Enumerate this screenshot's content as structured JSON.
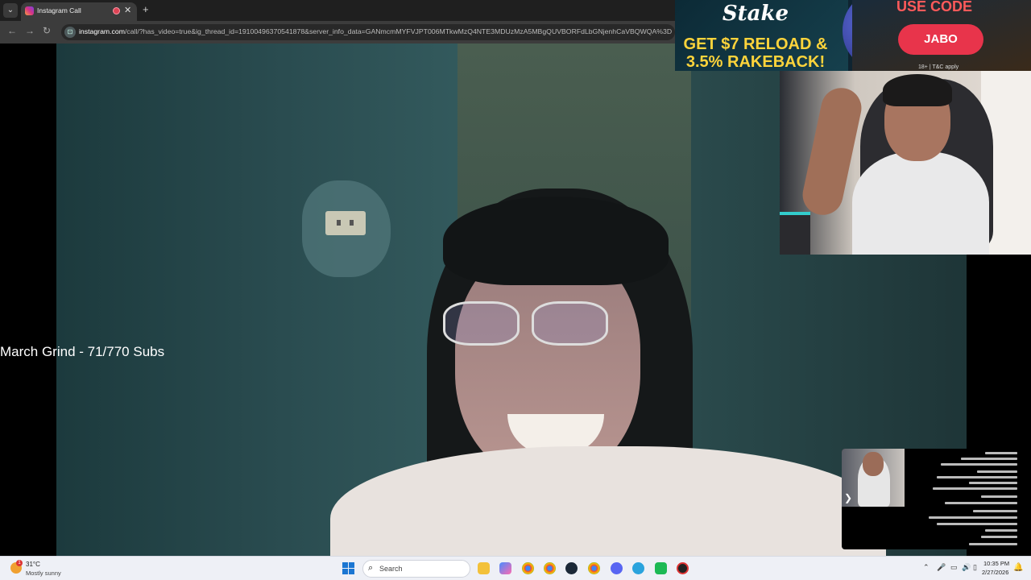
{
  "browser": {
    "tab_menu": "⌄",
    "tab_title": "Instagram Call",
    "tab_close": "✕",
    "new_tab": "+",
    "back": "←",
    "forward": "→",
    "reload": "↻",
    "url_host": "instagram.com",
    "url_path": "/call/?has_video=true&ig_thread_id=191004963705418​78&server_info_data=GANmcmMYFVJPT006MTkwMzQ4NTE3MDUzMzA5MBgQUVBORFdLbGNjenhCaVBQWQA%3D"
  },
  "overlay": {
    "subs_text": "March Grind - 71/770 Subs"
  },
  "ad": {
    "logo": "Stake",
    "headline_1": "GET $7 RELOAD &",
    "headline_2": "3.5% RAKEBACK!",
    "use_code": "USE CODE",
    "code": "JABO",
    "tc": "18+ | T&C apply"
  },
  "pip": {
    "toggle": "❯"
  },
  "taskbar": {
    "weather_badge": "1",
    "temperature": "31°C",
    "weather_desc": "Mostly sunny",
    "search_placeholder": "Search",
    "search_icon": "⌕",
    "tray_chevron": "⌃",
    "tray_mic": "🎤",
    "tray_net": "▭",
    "tray_sound": "🔊",
    "tray_battery": "▯",
    "time": "10:35 PM",
    "date": "2/27/2026",
    "notif": "🔔"
  },
  "colors": {
    "accent_ad_code": "#e8344b",
    "ad_headline": "#ffd43b",
    "taskbar_bg": "#eef0f6"
  }
}
